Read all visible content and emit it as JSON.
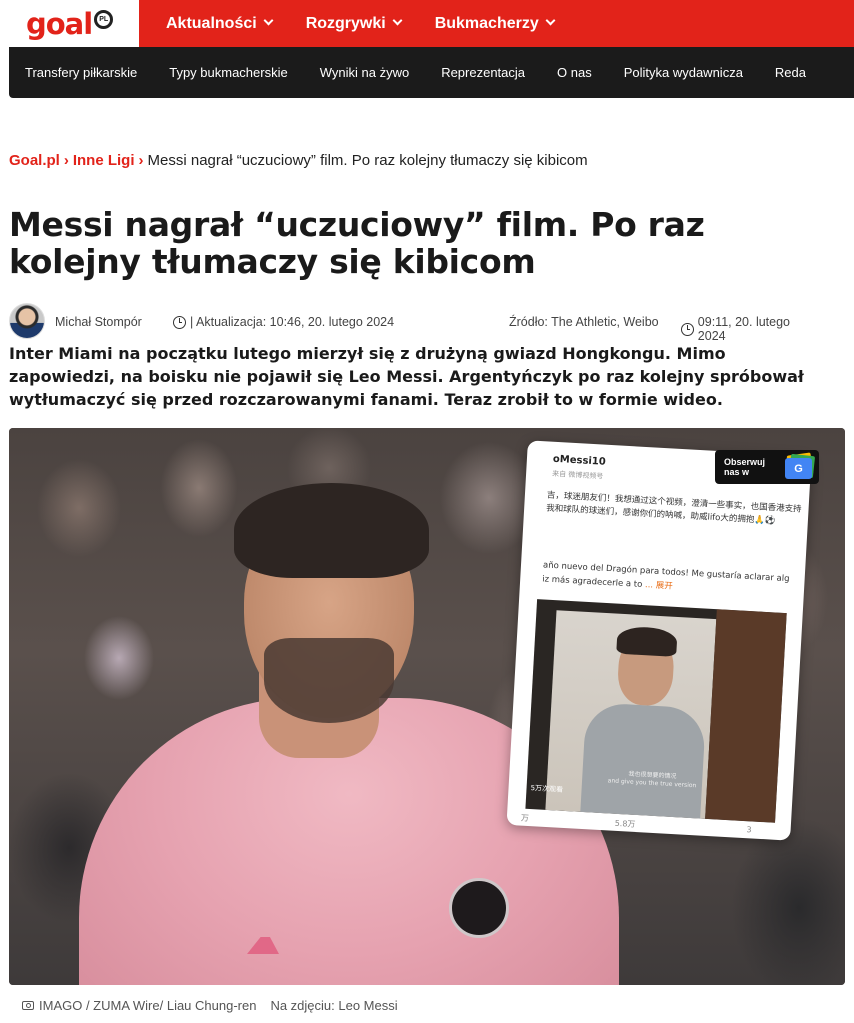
{
  "header": {
    "logo_text": "goal",
    "logo_badge": "PL",
    "brand_color": "#e2231a",
    "main_nav": [
      {
        "label": "Aktualności"
      },
      {
        "label": "Rozgrywki"
      },
      {
        "label": "Bukmacherzy"
      }
    ],
    "sub_nav": [
      {
        "label": "Transfery piłkarskie"
      },
      {
        "label": "Typy bukmacherskie"
      },
      {
        "label": "Wyniki na żywo"
      },
      {
        "label": "Reprezentacja"
      },
      {
        "label": "O nas"
      },
      {
        "label": "Polityka wydawnicza"
      },
      {
        "label": "Reda"
      }
    ]
  },
  "breadcrumb": {
    "items": [
      {
        "label": "Goal.pl"
      },
      {
        "label": "Inne Ligi"
      }
    ],
    "separator": "›",
    "current": "Messi nagrał “uczuciowy” film. Po raz kolejny tłumaczy się kibicom"
  },
  "article": {
    "title": "Messi nagrał “uczuciowy” film. Po raz kolejny tłumaczy się kibicom",
    "author": "Michał Stompór",
    "updated": "| Aktualizacja: 10:46, 20. lutego 2024",
    "source": "Źródło: The Athletic, Weibo",
    "published": "09:11, 20. lutego 2024",
    "lead": "Inter Miami na początku lutego mierzył się z drużyną gwiazd Hongkongu. Mimo zapowiedzi, na boisku nie pojawił się Leo Messi. Argentyńczyk po raz kolejny spróbował wytłumaczyć się przed rozczarowanymi fanami. Teraz zrobił to w formie wideo."
  },
  "hero": {
    "follow_label": "Obserwuj nas w",
    "follow_icon": "google-news-icon",
    "follow_icon_text": "G",
    "post": {
      "user": "oMessi10",
      "sub": "来自 微博视频号",
      "text_zh": "吉，球迷朋友们！我想通过这个视频，澄清一些事实，也国香港支持我和球队的球迷们，感谢你们的呐喊，助威lifo大的拥抱🙏⚽",
      "text_es": "año nuevo del Dragón para todos! Me gustaría aclarar alg iz más agradecerle a to",
      "more": "... 展开",
      "video_sub_zh": "我也很想要的情况",
      "video_sub_en": "and give you the true version",
      "video_views": "5万次观看",
      "foot_left": "万",
      "foot_mid": "5.8万",
      "foot_right": "3"
    }
  },
  "caption": {
    "credit": "IMAGO / ZUMA Wire/ Liau Chung-ren",
    "label": "Na zdjęciu: Leo Messi"
  }
}
